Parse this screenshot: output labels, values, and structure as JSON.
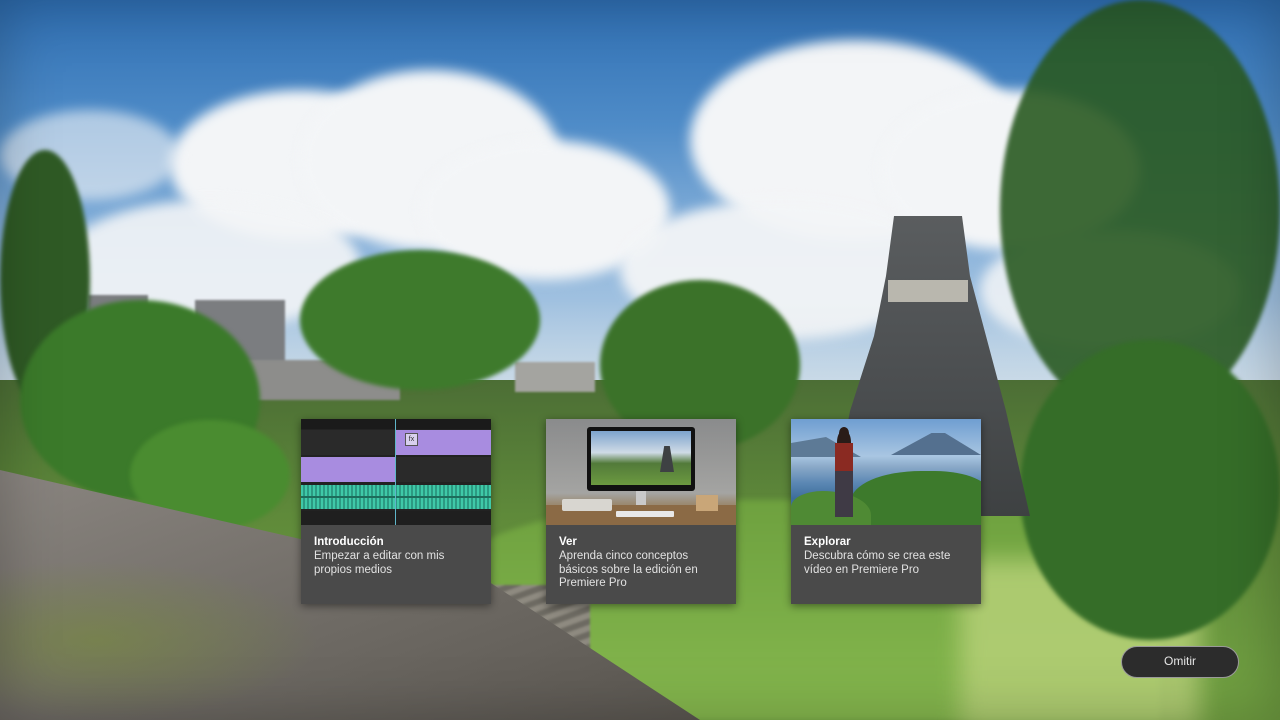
{
  "background": {
    "scene": "tikal-temple-background"
  },
  "cards": [
    {
      "title": "Introducción",
      "description": "Empezar a editar con mis propios medios",
      "thumbnail": "timeline-thumbnail"
    },
    {
      "title": "Ver",
      "description": "Aprenda cinco conceptos básicos sobre la edición en Premiere Pro",
      "thumbnail": "desktop-monitor-thumbnail"
    },
    {
      "title": "Explorar",
      "description": "Descubra cómo se crea este vídeo en Premiere Pro",
      "thumbnail": "lake-volcano-thumbnail"
    }
  ],
  "timeline_thumb": {
    "fx_badge": "fx"
  },
  "skip_button": {
    "label": "Omitir"
  },
  "colors": {
    "card_bg": "#4a4a4a",
    "clip_purple": "#a88ce0",
    "audio_teal": "#2c9a82",
    "skip_bg": "#2c2c2c"
  }
}
